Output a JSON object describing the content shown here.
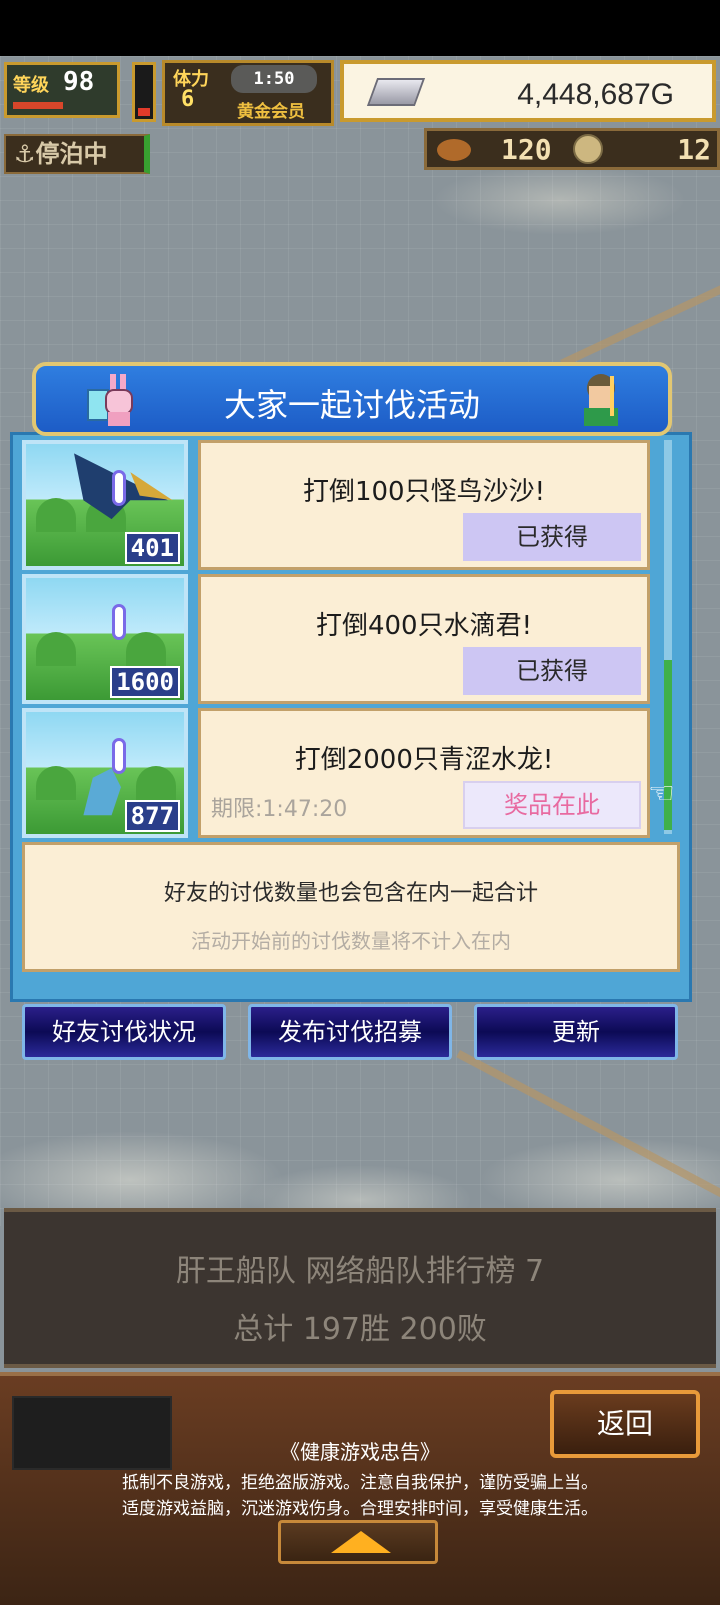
{
  "hud": {
    "level_label": "等级",
    "level": "98",
    "stamina_label": "体力",
    "stamina": "6",
    "timer": "1:50",
    "membership": "黄金会员",
    "gold": "4,448,687G",
    "status": "停泊中",
    "resource_1": "120",
    "resource_2": "12"
  },
  "event": {
    "title": "大家一起讨伐活动",
    "missions": [
      {
        "count": "401",
        "text": "打倒100只怪鸟沙沙!",
        "status": "已获得",
        "deadline": ""
      },
      {
        "count": "1600",
        "text": "打倒400只水滴君!",
        "status": "已获得",
        "deadline": ""
      },
      {
        "count": "877",
        "text": "打倒2000只青涩水龙!",
        "status": "奖品在此",
        "deadline": "期限:1:47:20"
      }
    ],
    "note_line1": "好友的讨伐数量也会包含在内一起合计",
    "note_line2": "活动开始前的讨伐数量将不计入在内"
  },
  "buttons": {
    "friend_status": "好友讨伐状况",
    "post_recruit": "发布讨伐招募",
    "refresh": "更新"
  },
  "fleet": {
    "line1": "肝王船队  网络船队排行榜  7",
    "line2": "总计 197胜 200败"
  },
  "footer": {
    "back": "返回",
    "health_title": "《健康游戏忠告》",
    "health_line1": "抵制不良游戏，拒绝盗版游戏。注意自我保护，谨防受骗上当。",
    "health_line2": "适度游戏益脑，沉迷游戏伤身。合理安排时间，享受健康生活。"
  },
  "colors": {
    "panel_blue": "#4fa6d6",
    "header_blue": "#1d5cc6",
    "card_cream": "#fbeed5",
    "obtained_lavender": "#cdc6f3",
    "prize_pink": "#e86aa0",
    "button_navy": "#0c0a55"
  }
}
